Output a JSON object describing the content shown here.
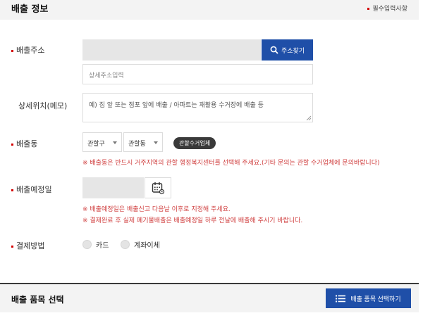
{
  "header": {
    "title": "배출 정보",
    "required_note": "필수입력사항"
  },
  "address": {
    "label": "배출주소",
    "search_button": "주소찾기",
    "detail_placeholder": "상세주소입력"
  },
  "memo": {
    "label": "상세위치(메모)",
    "placeholder": "예) 집 앞 또는 점포 앞에 배출 / 아파트는 재활용 수거장에 배출 등"
  },
  "district": {
    "label": "배출동",
    "gu_selected": "관할구",
    "dong_selected": "관할동",
    "collector_button": "관할수거업체",
    "note": "※ 배출동은 반드시 거주지역의 관할 행정복지센터를 선택해 주세요.(기타 문의는 관할 수거업체에 문의바랍니다)"
  },
  "date": {
    "label": "배출예정일",
    "note1": "※ 배출예정일은 배출신고 다음날 이후로 지정해 주세요.",
    "note2": "※ 결제완료 후 실제 폐기물배출은 배출예정일 하루 전날에 배출해 주시기 바랍니다."
  },
  "payment": {
    "label": "결제방법",
    "options": [
      "카드",
      "계좌이체"
    ]
  },
  "items_section": {
    "title": "배출 품목 선택",
    "select_button": "배출 품목 선택하기"
  },
  "colors": {
    "accent_blue": "#1f4fa8",
    "required_red": "#d40000",
    "note_red": "#d04040"
  }
}
